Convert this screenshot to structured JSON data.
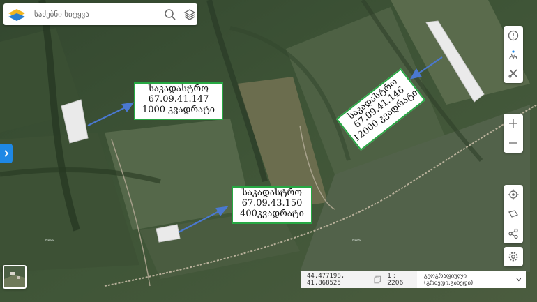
{
  "search": {
    "placeholder": "საძებნი სიტყვა"
  },
  "labels": [
    {
      "line1": "საკადასტრო",
      "line2": "67.09.41.147",
      "line3": "1000 კვადრატი"
    },
    {
      "line1": "საკადასტრო",
      "line2": "67.09.43.150",
      "line3": "400კვადრატი"
    },
    {
      "line1": "საკადასტრო",
      "line2": "67.09.41.146",
      "line3": "12000 კვადრატი"
    }
  ],
  "watermark": "NAPR",
  "statusbar": {
    "coordinates": "44.477198, 41.868525",
    "scale": "1 : 2206",
    "projection": "გეოგრაფიული (გრძედი,განედი)"
  },
  "colors": {
    "label_border": "#27a843",
    "arrow": "#4a78d0",
    "accent": "#1e88e5"
  },
  "icons": [
    "search-icon",
    "layers-icon",
    "info-icon",
    "locate-user-icon",
    "tools-icon",
    "zoom-in-icon",
    "zoom-out-icon",
    "target-icon",
    "measure-icon",
    "share-icon",
    "settings-icon",
    "chevron-right-icon"
  ]
}
